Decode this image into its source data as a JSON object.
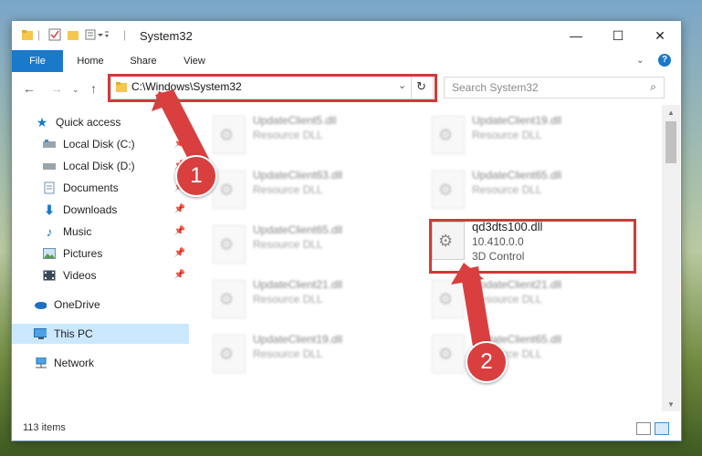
{
  "window": {
    "title": "System32",
    "tabs": [
      "File",
      "Home",
      "Share",
      "View"
    ],
    "controls": {
      "minimize": "—",
      "maximize": "☐",
      "close": "✕"
    }
  },
  "address": {
    "path": "C:\\Windows\\System32",
    "search_placeholder": "Search System32"
  },
  "nav_pane": {
    "items": [
      {
        "label": "Quick access",
        "icon": "star-icon",
        "pinned": false
      },
      {
        "label": "Local Disk (C:)",
        "icon": "drive-icon",
        "pinned": true
      },
      {
        "label": "Local Disk (D:)",
        "icon": "drive-icon",
        "pinned": true
      },
      {
        "label": "Documents",
        "icon": "documents-icon",
        "pinned": true
      },
      {
        "label": "Downloads",
        "icon": "download-icon",
        "pinned": true
      },
      {
        "label": "Music",
        "icon": "music-icon",
        "pinned": true
      },
      {
        "label": "Pictures",
        "icon": "pictures-icon",
        "pinned": true
      },
      {
        "label": "Videos",
        "icon": "videos-icon",
        "pinned": true
      },
      {
        "label": "OneDrive",
        "icon": "onedrive-icon",
        "pinned": false
      },
      {
        "label": "This PC",
        "icon": "pc-icon",
        "pinned": false,
        "selected": true
      },
      {
        "label": "Network",
        "icon": "network-icon",
        "pinned": false
      }
    ]
  },
  "files": [
    {
      "name": "UpdateClient5.dll",
      "type": "Resource DLL",
      "blurred": true
    },
    {
      "name": "UpdateClient19.dll",
      "type": "Resource DLL",
      "blurred": true
    },
    {
      "name": "UpdateClient63.dll",
      "type": "Resource DLL",
      "blurred": true
    },
    {
      "name": "UpdateClient65.dll",
      "type": "Resource DLL",
      "blurred": true
    },
    {
      "name": "UpdateClient65.dll",
      "type": "Resource DLL",
      "blurred": true
    },
    {
      "name": "qd3dts100.dll",
      "version": "10.410.0.0",
      "type": "3D Control",
      "blurred": false,
      "highlighted": true
    },
    {
      "name": "UpdateClient21.dll",
      "type": "Resource DLL",
      "blurred": true
    },
    {
      "name": "UpdateClient21.dll",
      "type": "Resource DLL",
      "blurred": true
    },
    {
      "name": "UpdateClient19.dll",
      "type": "Resource DLL",
      "blurred": true
    },
    {
      "name": "UpdateClient65.dll",
      "type": "Resource DLL",
      "blurred": true
    }
  ],
  "status": {
    "item_count": "113 items"
  },
  "annotations": {
    "step1": "1",
    "step2": "2",
    "color": "#d03a3a"
  }
}
